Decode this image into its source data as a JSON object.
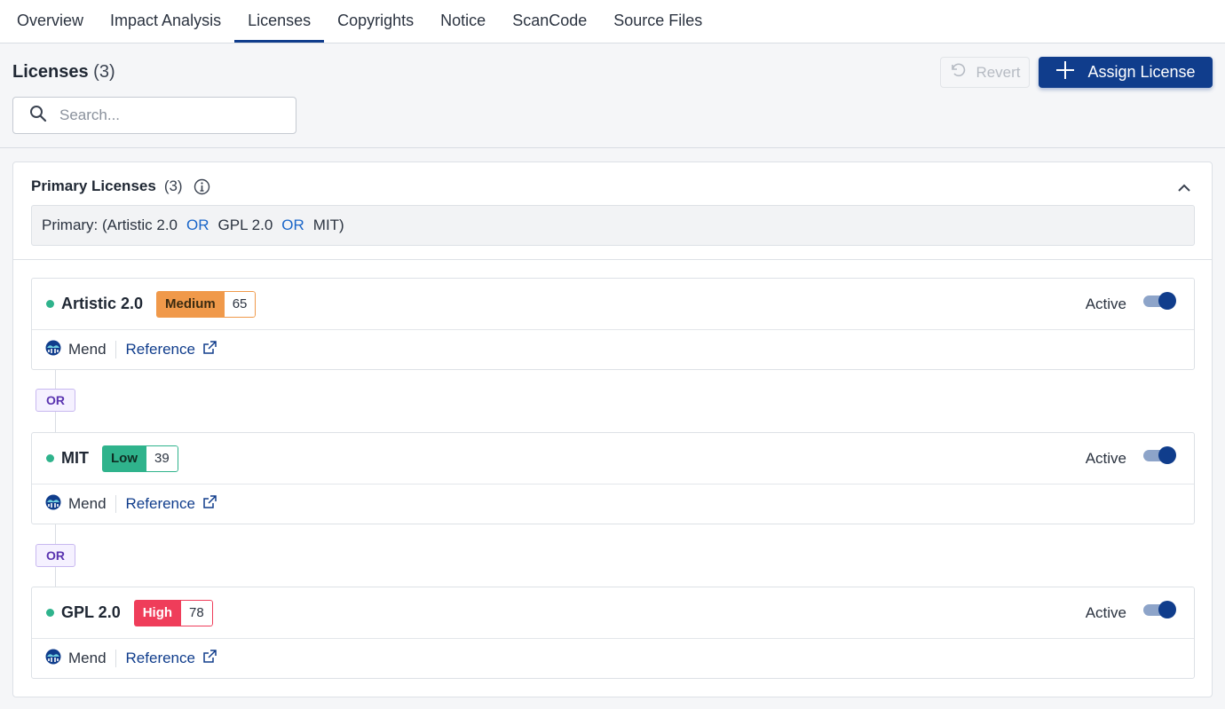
{
  "tabs": [
    {
      "label": "Overview",
      "active": false
    },
    {
      "label": "Impact Analysis",
      "active": false
    },
    {
      "label": "Licenses",
      "active": true
    },
    {
      "label": "Copyrights",
      "active": false
    },
    {
      "label": "Notice",
      "active": false
    },
    {
      "label": "ScanCode",
      "active": false
    },
    {
      "label": "Source Files",
      "active": false
    }
  ],
  "header": {
    "title": "Licenses",
    "count": "(3)",
    "search_placeholder": "Search...",
    "revert_label": "Revert",
    "assign_label": "Assign License"
  },
  "primary": {
    "title": "Primary Licenses",
    "count": "(3)",
    "expr_prefix": "Primary: (Artistic 2.0",
    "expr_op1": "OR",
    "expr_mid": "GPL 2.0",
    "expr_op2": "OR",
    "expr_suffix": "MIT)"
  },
  "licenses": [
    {
      "name": "Artistic 2.0",
      "risk": "Medium",
      "score": "65",
      "status": "Active",
      "source": "Mend",
      "reference": "Reference",
      "risk_color": "#f0994a",
      "active": true
    },
    {
      "name": "MIT",
      "risk": "Low",
      "score": "39",
      "status": "Active",
      "source": "Mend",
      "reference": "Reference",
      "risk_color": "#2fb38c",
      "active": true
    },
    {
      "name": "GPL 2.0",
      "risk": "High",
      "score": "78",
      "status": "Active",
      "source": "Mend",
      "reference": "Reference",
      "risk_color": "#ef3d5a",
      "active": true
    }
  ],
  "operators": [
    "OR",
    "OR"
  ],
  "colors": {
    "accent": "#103d8c",
    "link": "#1a66c9",
    "operator": "#5a34b0"
  }
}
